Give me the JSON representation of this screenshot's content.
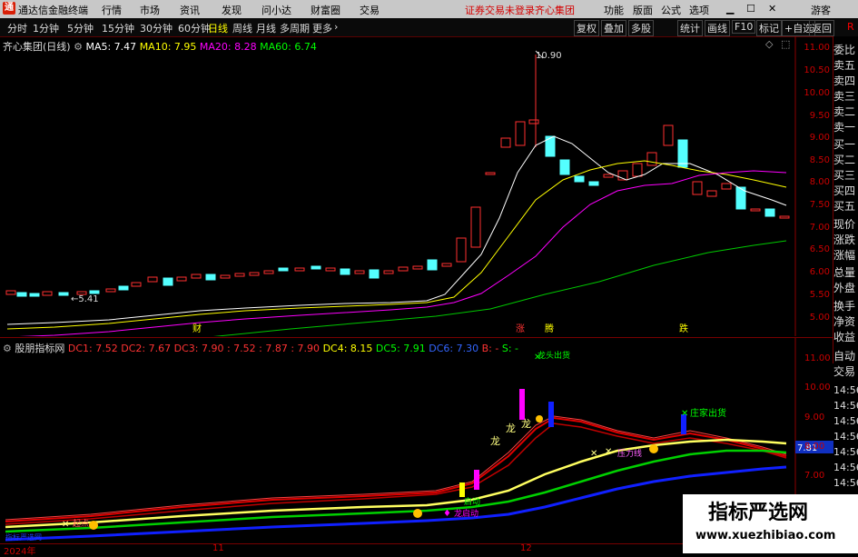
{
  "app": {
    "title": "通达信金融终端",
    "menu": [
      "行情",
      "市场",
      "资讯",
      "发现",
      "问小达",
      "财富圈",
      "交易"
    ],
    "warning": "证券交易未登录",
    "stock_tag": "齐心集团",
    "right_menu": [
      "功能",
      "版面",
      "公式",
      "选项"
    ],
    "guest": "游客",
    "window_icons": [
      "min-icon",
      "max-icon",
      "close-icon"
    ]
  },
  "toolbar": {
    "periods": [
      "分时",
      "1分钟",
      "5分钟",
      "15分钟",
      "30分钟",
      "60分钟",
      "日线",
      "周线",
      "月线",
      "多周期",
      "更多"
    ],
    "active_period": "日线",
    "more_arrow": "›",
    "buttons": [
      "复权",
      "叠加",
      "多股",
      "统计",
      "画线",
      "F10",
      "标记",
      "+自选",
      "返回"
    ],
    "r_label": "R"
  },
  "main_chart": {
    "name": "齐心集团(日线)",
    "ma": [
      {
        "label": "MA5: 7.47",
        "color": "#ffffff"
      },
      {
        "label": "MA10: 7.95",
        "color": "#ffff00"
      },
      {
        "label": "MA20: 8.28",
        "color": "#ff00ff"
      },
      {
        "label": "MA60: 6.74",
        "color": "#00ff00"
      }
    ],
    "y_ticks": [
      "11.00",
      "10.50",
      "10.00",
      "9.50",
      "9.00",
      "8.50",
      "8.00",
      "7.50",
      "7.00",
      "6.50",
      "6.00",
      "5.50",
      "5.00"
    ],
    "high_label": "10.90",
    "low_label": "5.41",
    "events": [
      "财",
      "涨",
      "腾",
      "跌"
    ]
  },
  "right_panel": [
    "委比",
    "卖五",
    "卖四",
    "卖三",
    "卖二",
    "卖一",
    "买一",
    "买二",
    "买三",
    "买四",
    "买五",
    "现价",
    "涨跌",
    "涨幅",
    "总量",
    "外盘",
    "换手",
    "净资",
    "收益",
    "自动",
    "交易"
  ],
  "right_panel_sub": [
    "14:56",
    "14:56",
    "14:56",
    "14:56",
    "14:56",
    "14:56",
    "14:56"
  ],
  "indicator": {
    "name": "股朋指标网",
    "dc": [
      {
        "label": "DC1: 7.52",
        "color": "#ff3030"
      },
      {
        "label": "DC2: 7.67",
        "color": "#ff3030"
      },
      {
        "label": "DC3: 7.90",
        "color": "#ff3030"
      },
      {
        "label": ": 7.52",
        "color": "#ff3030"
      },
      {
        "label": ": 7.87",
        "color": "#ff3030"
      },
      {
        "label": ": 7.90",
        "color": "#ff3030"
      },
      {
        "label": "DC4: 8.15",
        "color": "#ffff00"
      },
      {
        "label": "DC5: 7.91",
        "color": "#00ff00"
      },
      {
        "label": "DC6: 7.30",
        "color": "#3060ff"
      },
      {
        "label": "B: -",
        "color": "#ff3030"
      },
      {
        "label": "S: -",
        "color": "#00ff00"
      }
    ],
    "y_ticks": [
      "11.00",
      "10.00",
      "9.00",
      "8.00",
      "7.00"
    ],
    "current_value": "7.81",
    "labels": {
      "dragon1": "龙",
      "dragon2": "龙",
      "dragon3": "龙",
      "launch": "启动",
      "launch_main": "龙启动",
      "banker_exit": "庄家出货",
      "top_label": "龙头出货",
      "pressure": "压力线",
      "start": "起点"
    }
  },
  "x_axis": [
    "2024年",
    "11",
    "12"
  ],
  "watermark": {
    "title": "指标严选网",
    "url": "www.xuezhibiao.com"
  }
}
